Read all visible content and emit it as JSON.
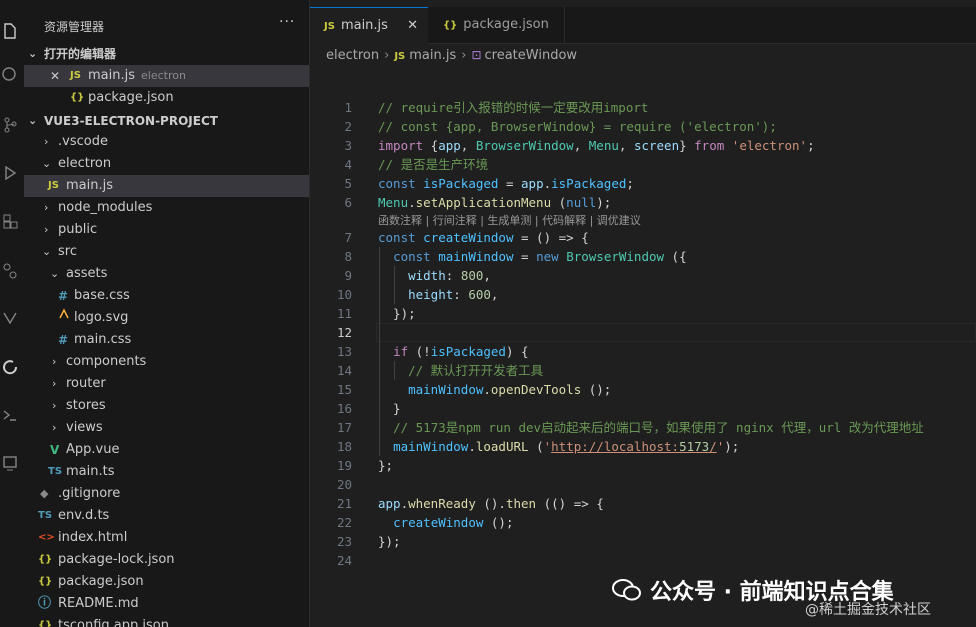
{
  "activity_icons": [
    "files-icon",
    "search-icon",
    "source-control-icon",
    "run-debug-icon",
    "extensions-icon",
    "remote-explorer-icon",
    "testing-icon",
    "edge-tools-icon",
    "debug-console-icon",
    "panel-icon"
  ],
  "sidebar": {
    "title": "资源管理器",
    "more": "···",
    "open_editors": {
      "label": "打开的编辑器",
      "items": [
        {
          "name": "main.js",
          "sub": "electron",
          "icon": "JS"
        },
        {
          "name": "package.json",
          "icon": "{}"
        }
      ]
    },
    "project": {
      "label": "VUE3-ELECTRON-PROJECT",
      "items": [
        {
          "name": ".vscode",
          "kind": "folder"
        },
        {
          "name": "electron",
          "kind": "folder"
        },
        {
          "name": "main.js",
          "kind": "file",
          "icon": "JS"
        },
        {
          "name": "node_modules",
          "kind": "folder"
        },
        {
          "name": "public",
          "kind": "folder"
        },
        {
          "name": "src",
          "kind": "folder"
        },
        {
          "name": "assets",
          "kind": "folder"
        },
        {
          "name": "base.css",
          "kind": "file",
          "icon": "#"
        },
        {
          "name": "logo.svg",
          "kind": "file",
          "icon": "svg"
        },
        {
          "name": "main.css",
          "kind": "file",
          "icon": "#"
        },
        {
          "name": "components",
          "kind": "folder"
        },
        {
          "name": "router",
          "kind": "folder"
        },
        {
          "name": "stores",
          "kind": "folder"
        },
        {
          "name": "views",
          "kind": "folder"
        },
        {
          "name": "App.vue",
          "kind": "file",
          "icon": "V"
        },
        {
          "name": "main.ts",
          "kind": "file",
          "icon": "TS"
        },
        {
          "name": ".gitignore",
          "kind": "file",
          "icon": "◆"
        },
        {
          "name": "env.d.ts",
          "kind": "file",
          "icon": "TS"
        },
        {
          "name": "index.html",
          "kind": "file",
          "icon": "<>"
        },
        {
          "name": "package-lock.json",
          "kind": "file",
          "icon": "{}"
        },
        {
          "name": "package.json",
          "kind": "file",
          "icon": "{}"
        },
        {
          "name": "README.md",
          "kind": "file",
          "icon": "ⓘ"
        },
        {
          "name": "tsconfig.app.json",
          "kind": "file",
          "icon": "{}"
        }
      ]
    }
  },
  "tabs": [
    {
      "label": "main.js",
      "icon": "JS",
      "active": true,
      "close": "✕"
    },
    {
      "label": "package.json",
      "icon": "{}",
      "active": false
    }
  ],
  "breadcrumb": [
    "electron",
    "main.js",
    "createWindow"
  ],
  "codelens": "函数注释 | 行间注释 | 生成单测 | 代码解释 | 调优建议",
  "line_numbers": [
    "1",
    "2",
    "3",
    "4",
    "5",
    "6",
    "7",
    "8",
    "9",
    "10",
    "11",
    "12",
    "13",
    "14",
    "15",
    "16",
    "17",
    "18",
    "19",
    "20",
    "21",
    "22",
    "23",
    "24"
  ],
  "code_lines": [
    "// require引入报错的时候一定要改用import",
    "// const {app, BrowserWindow} = require ('electron');",
    "import {app, BrowserWindow, Menu, screen} from 'electron';",
    "// 是否是生产环境",
    "const isPackaged = app.isPackaged;",
    "Menu.setApplicationMenu (null);",
    "const createWindow = () => {",
    "  const mainWindow = new BrowserWindow ({",
    "    width: 800,",
    "    height: 600,",
    "  });",
    "",
    "  if (!isPackaged) {",
    "    // 默认打开开发者工具",
    "    mainWindow.openDevTools ();",
    "  }",
    "  // 5173是npm run dev启动起来后的端口号，如果使用了 nginx 代理，url 改为代理地址",
    "  mainWindow.loadURL ('http://localhost:5173/');",
    "};",
    "",
    "app.whenReady ().then (() => {",
    "  createWindow ();",
    "});",
    ""
  ],
  "current_line": "12",
  "watermark": {
    "main": "公众号 · 前端知识点合集",
    "sub": "@稀土掘金技术社区"
  }
}
